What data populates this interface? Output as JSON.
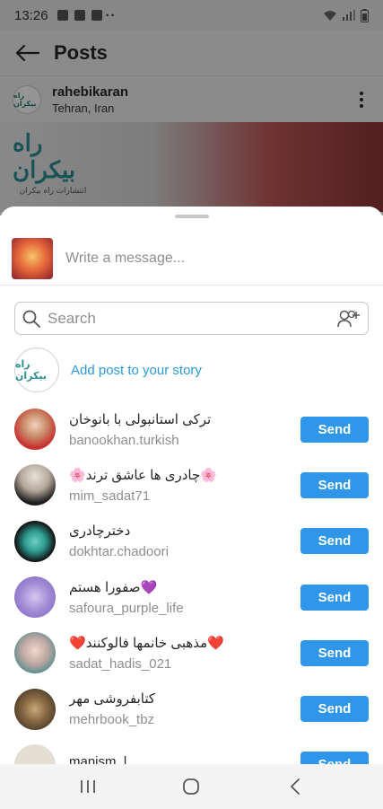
{
  "status_bar": {
    "time": "13:26",
    "dots": "··"
  },
  "header": {
    "title": "Posts"
  },
  "post": {
    "username": "rahebikaran",
    "location": "Tehran, Iran",
    "avatar_text": "راه بیکران",
    "brand_logo_text": "راه بیکران",
    "brand_logo_sub": "انتشارات راه بیکران"
  },
  "share": {
    "message_placeholder": "Write a message...",
    "search_placeholder": "Search",
    "add_story_label": "Add post to your story",
    "story_avatar_text": "راه بیکران",
    "send_label": "Send",
    "contacts": [
      {
        "name": "ترکی استانبولی با بانوخان",
        "handle": "banookhan.turkish"
      },
      {
        "name": "🌸چادری ها عاشق ترند🌸",
        "handle": "mim_sadat71"
      },
      {
        "name": "دختر‌چادری",
        "handle": "dokhtar.chadoori"
      },
      {
        "name": "صفورا هستم💜",
        "handle": "safoura_purple_life"
      },
      {
        "name": "❤️مذهبی خانمها فالوکنند❤️",
        "handle": "sadat_hadis_021"
      },
      {
        "name": "کتابفروشی مهر",
        "handle": "mehrbook_tbz"
      },
      {
        "name": "manism_l",
        "handle": ""
      }
    ]
  },
  "colors": {
    "accent": "#2f96ea",
    "link": "#2b9ad6"
  }
}
